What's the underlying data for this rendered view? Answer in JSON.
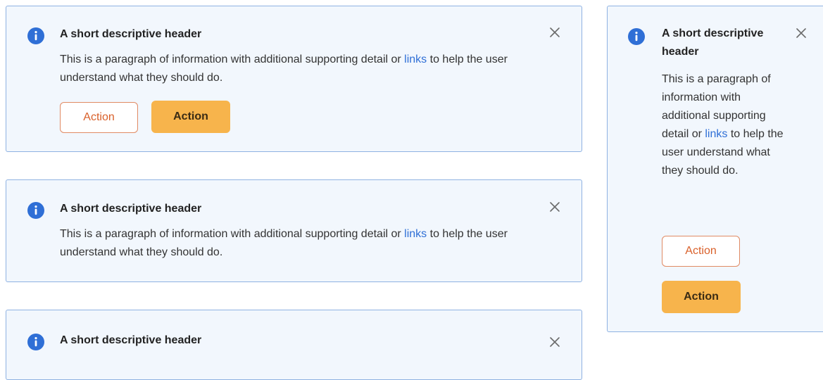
{
  "colors": {
    "alert_background": "#f2f7fd",
    "alert_border": "#8fb2e2",
    "info_icon": "#2f6fd6",
    "link": "#2f6fd6",
    "outline_button_border": "#e08a63",
    "outline_button_text": "#d9602a",
    "filled_button_background": "#f7b44c"
  },
  "alerts": [
    {
      "icon": "info-icon",
      "header": "A short descriptive header",
      "body_before_link": "This is a paragraph of information with additional supporting detail or ",
      "link_text": "links",
      "body_after_link": " to help the user understand what they should do.",
      "secondary_action": "Action",
      "primary_action": "Action"
    },
    {
      "icon": "info-icon",
      "header": "A short descriptive header",
      "body_before_link": "This is a paragraph of information with additional supporting detail or ",
      "link_text": "links",
      "body_after_link": " to help the user understand what they should do."
    },
    {
      "icon": "info-icon",
      "header": "A short descriptive header"
    },
    {
      "icon": "info-icon",
      "header": "A short descriptive header",
      "body_before_link": "This is a paragraph of information with additional supporting detail or ",
      "link_text": "links",
      "body_after_link": " to help the user understand what they should do.",
      "secondary_action": "Action",
      "primary_action": "Action"
    }
  ]
}
